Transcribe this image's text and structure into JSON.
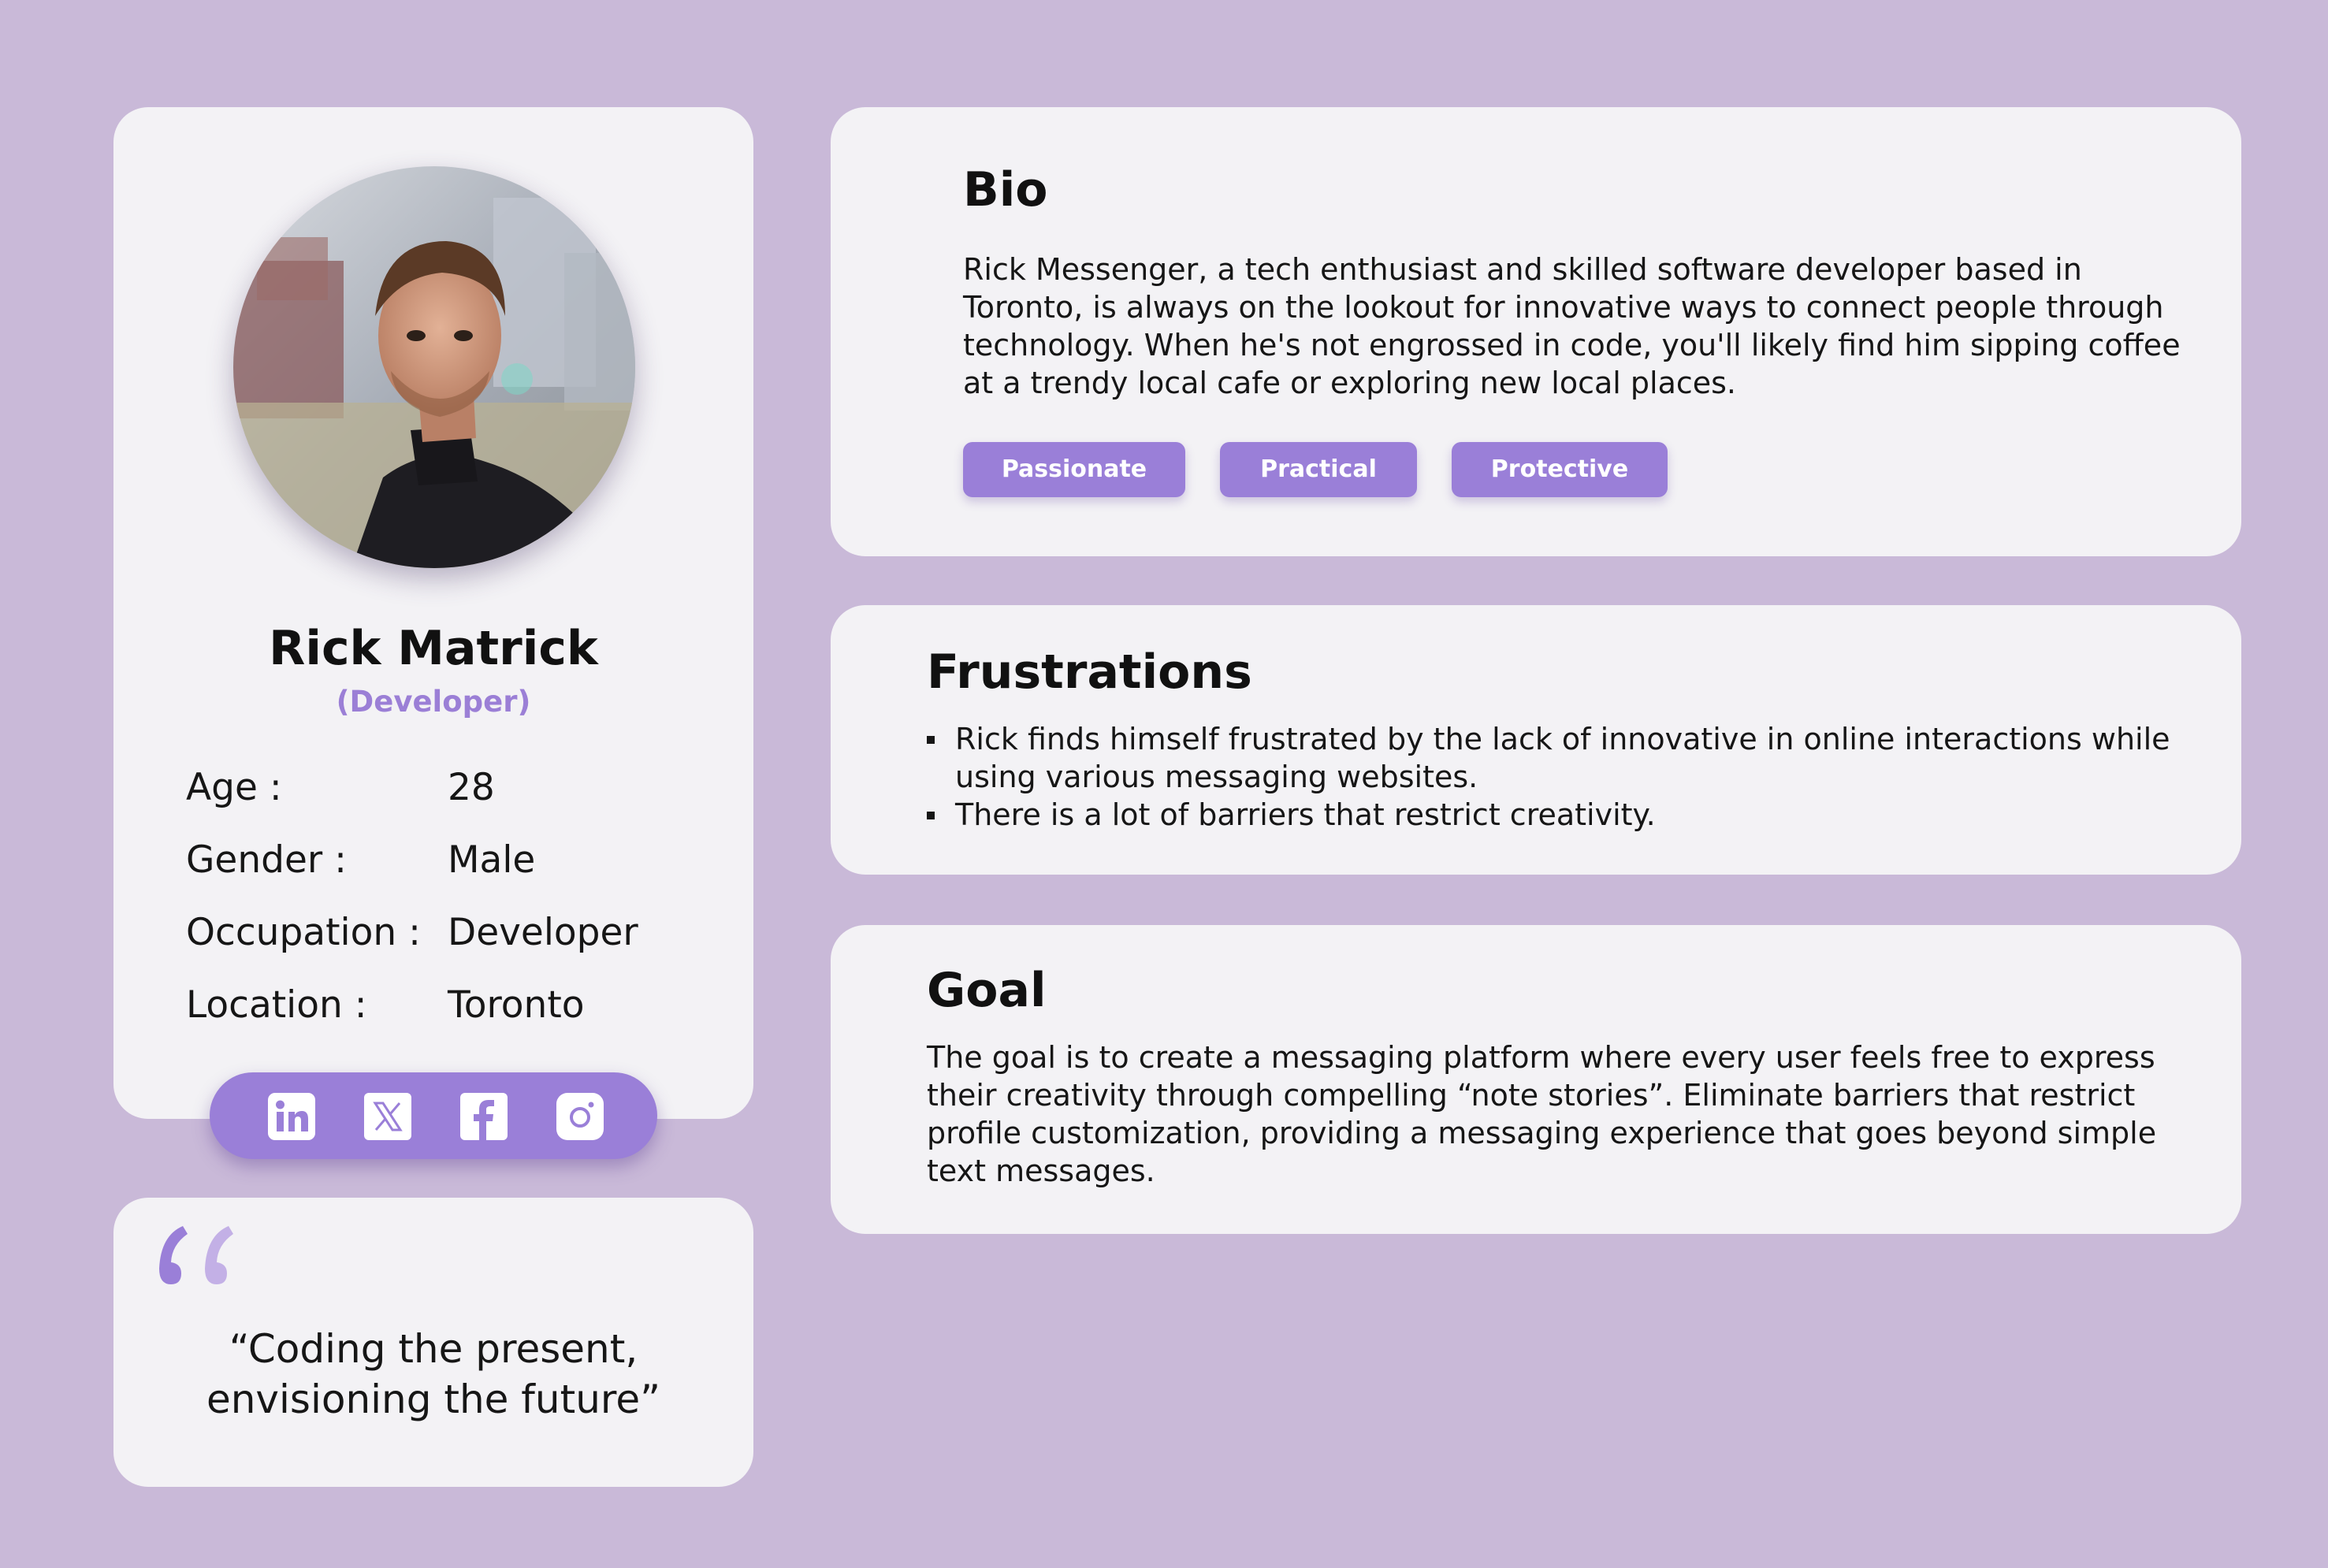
{
  "profile": {
    "name": "Rick Matrick",
    "role": "(Developer)",
    "details": [
      {
        "label": "Age :",
        "value": "28"
      },
      {
        "label": "Gender :",
        "value": "Male"
      },
      {
        "label": "Occupation :",
        "value": "Developer"
      },
      {
        "label": "Location :",
        "value": "Toronto"
      }
    ],
    "social": [
      "linkedin-icon",
      "x-icon",
      "facebook-icon",
      "instagram-icon"
    ]
  },
  "quote": {
    "text": "“Coding the present, envisioning the future”"
  },
  "bio": {
    "title": "Bio",
    "text": "Rick Messenger, a tech enthusiast and skilled software developer based in Toronto, is always on the lookout for innovative ways to connect people through technology. When he's not engrossed in code, you'll likely find him sipping coffee at a trendy local cafe or exploring new local places.",
    "tags": [
      "Passionate",
      "Practical",
      "Protective"
    ]
  },
  "frustrations": {
    "title": "Frustrations",
    "items": [
      "Rick finds himself frustrated by the lack of innovative in online interactions while using various messaging websites.",
      "There is a lot of barriers that restrict creativity."
    ]
  },
  "goal": {
    "title": "Goal",
    "text": "The goal is to create a messaging platform where every user feels free to express their creativity through compelling “note stories”.  Eliminate barriers that restrict profile customization, providing a messaging experience that goes beyond simple text messages."
  },
  "colors": {
    "background": "#c9b9d8",
    "card": "#f3f2f5",
    "accent": "#9a7fd8",
    "role_text": "#9b7fd6"
  }
}
